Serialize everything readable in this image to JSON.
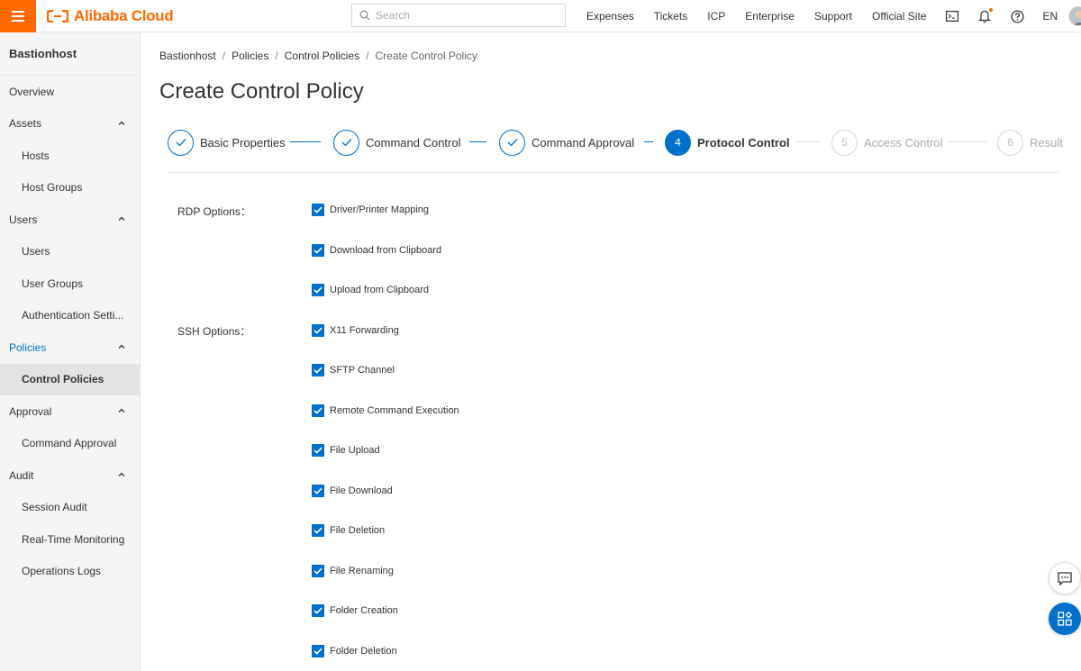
{
  "topbar": {
    "brand": "Alibaba Cloud",
    "search_placeholder": "Search",
    "links": [
      "Expenses",
      "Tickets",
      "ICP",
      "Enterprise",
      "Support",
      "Official Site"
    ],
    "language": "EN"
  },
  "sidebar": {
    "title": "Bastionhost",
    "items": [
      {
        "label": "Overview",
        "level": 0
      },
      {
        "label": "Assets",
        "level": 0,
        "expandable": true
      },
      {
        "label": "Hosts",
        "level": 1
      },
      {
        "label": "Host Groups",
        "level": 1
      },
      {
        "label": "Users",
        "level": 0,
        "expandable": true
      },
      {
        "label": "Users",
        "level": 1
      },
      {
        "label": "User Groups",
        "level": 1
      },
      {
        "label": "Authentication Setti...",
        "level": 1
      },
      {
        "label": "Policies",
        "level": 0,
        "expandable": true,
        "active_group": true
      },
      {
        "label": "Control Policies",
        "level": 1,
        "active": true
      },
      {
        "label": "Approval",
        "level": 0,
        "expandable": true
      },
      {
        "label": "Command Approval",
        "level": 1
      },
      {
        "label": "Audit",
        "level": 0,
        "expandable": true
      },
      {
        "label": "Session Audit",
        "level": 1
      },
      {
        "label": "Real-Time Monitoring",
        "level": 1
      },
      {
        "label": "Operations Logs",
        "level": 1
      }
    ]
  },
  "breadcrumb": [
    "Bastionhost",
    "Policies",
    "Control Policies",
    "Create Control Policy"
  ],
  "page_title": "Create Control Policy",
  "steps": [
    {
      "number": "1",
      "label": "Basic Properties",
      "status": "done"
    },
    {
      "number": "2",
      "label": "Command Control",
      "status": "done"
    },
    {
      "number": "3",
      "label": "Command Approval",
      "status": "done"
    },
    {
      "number": "4",
      "label": "Protocol Control",
      "status": "active"
    },
    {
      "number": "5",
      "label": "Access Control",
      "status": "pending"
    },
    {
      "number": "6",
      "label": "Result",
      "status": "pending"
    }
  ],
  "rdp": {
    "label": "RDP Options",
    "options": [
      {
        "label": "Driver/Printer Mapping",
        "checked": true
      },
      {
        "label": "Download from Clipboard",
        "checked": true
      },
      {
        "label": "Upload from Clipboard",
        "checked": true
      }
    ]
  },
  "ssh": {
    "label": "SSH Options",
    "options": [
      {
        "label": "X11 Forwarding",
        "checked": true
      },
      {
        "label": "SFTP Channel",
        "checked": true
      },
      {
        "label": "Remote Command Execution",
        "checked": true
      },
      {
        "label": "File Upload",
        "checked": true
      },
      {
        "label": "File Download",
        "checked": true
      },
      {
        "label": "File Deletion",
        "checked": true
      },
      {
        "label": "File Renaming",
        "checked": true
      },
      {
        "label": "Folder Creation",
        "checked": true
      },
      {
        "label": "Folder Deletion",
        "checked": true
      }
    ]
  },
  "colors": {
    "brand": "#ff6a00",
    "primary": "#0070cc"
  }
}
